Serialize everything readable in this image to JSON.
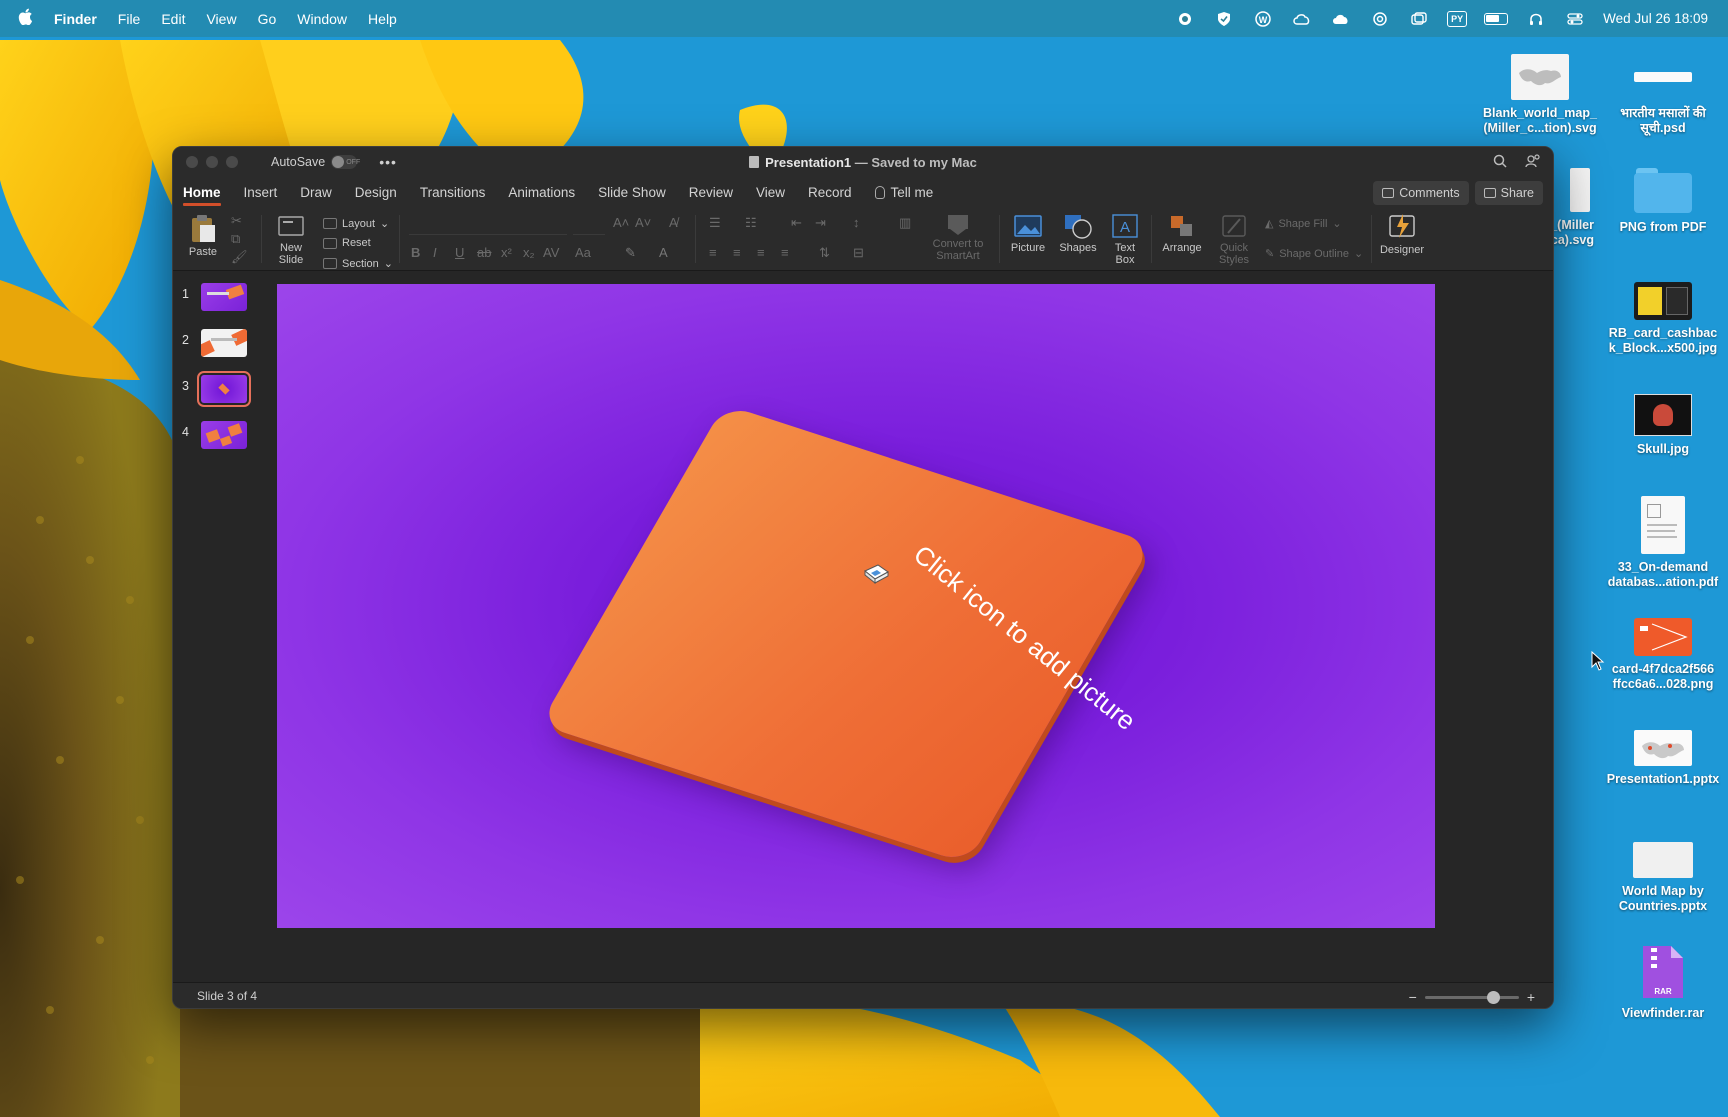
{
  "menubar": {
    "app_name": "Finder",
    "items": [
      "File",
      "Edit",
      "View",
      "Go",
      "Window",
      "Help"
    ],
    "clock": "Wed Jul 26  18:09",
    "status_icons": [
      "record-icon",
      "shield-icon",
      "w-icon",
      "cloud-sync-icon",
      "icloud-icon",
      "target-icon",
      "window-icon",
      "py-icon",
      "battery-icon",
      "headphones-icon",
      "control-center-icon"
    ],
    "py_label": "PY"
  },
  "desktop": {
    "files": [
      {
        "name": "Blank_world_map_ (Miller_c...tion).svg",
        "icon": "world-map-thumb"
      },
      {
        "name": "भारतीय मसालों की सूची.psd",
        "icon": "psd-thumb"
      },
      {
        "name": "_(Miller ca).svg",
        "icon": "svg-thumb"
      },
      {
        "name": "PNG from PDF",
        "icon": "folder-icon"
      },
      {
        "name": "RB_card_cashbac k_Block...x500.jpg",
        "icon": "card-thumb"
      },
      {
        "name": "Skull.jpg",
        "icon": "skull-thumb"
      },
      {
        "name": "33_On-demand databas...ation.pdf",
        "icon": "pdf-thumb"
      },
      {
        "name": "card-4f7dca2f566 ffcc6a6...028.png",
        "icon": "card-orange-thumb"
      },
      {
        "name": "Presentation1.pptx",
        "icon": "pptx-thumb"
      },
      {
        "name": "World Map by Countries.pptx",
        "icon": "pptx-blank-thumb"
      },
      {
        "name": "Viewfinder.rar",
        "icon": "rar-icon"
      }
    ],
    "rar_label": "RAR"
  },
  "window": {
    "autosave_label": "AutoSave",
    "autosave_state": "OFF",
    "more_label": "•••",
    "title": "Presentation1",
    "title_suffix": " — Saved to my Mac",
    "tabs": [
      "Home",
      "Insert",
      "Draw",
      "Design",
      "Transitions",
      "Animations",
      "Slide Show",
      "Review",
      "View",
      "Record"
    ],
    "active_tab": "Home",
    "tell_me": "Tell me",
    "comments_label": "Comments",
    "share_label": "Share"
  },
  "ribbon": {
    "paste": "Paste",
    "new_slide": [
      "New",
      "Slide"
    ],
    "layout": "Layout",
    "reset": "Reset",
    "section": "Section",
    "convert_smartart": [
      "Convert to",
      "SmartArt"
    ],
    "picture": "Picture",
    "shapes": "Shapes",
    "text_box": [
      "Text",
      "Box"
    ],
    "arrange": "Arrange",
    "quick_styles": [
      "Quick",
      "Styles"
    ],
    "shape_fill": "Shape Fill",
    "shape_outline": "Shape Outline",
    "designer": "Designer"
  },
  "thumbnails": [
    {
      "number": "1",
      "selected": false
    },
    {
      "number": "2",
      "selected": false
    },
    {
      "number": "3",
      "selected": true
    },
    {
      "number": "4",
      "selected": false
    }
  ],
  "slide": {
    "placeholder_text": "Click icon to add picture",
    "background_color": "#8a2be2",
    "card_color": "#f07a3c"
  },
  "status": {
    "slide_count": "Slide 3 of 4",
    "zoom_minus": "−",
    "zoom_plus": "+"
  },
  "colors": {
    "accent": "#d34f2a",
    "selection": "#e5705a"
  }
}
